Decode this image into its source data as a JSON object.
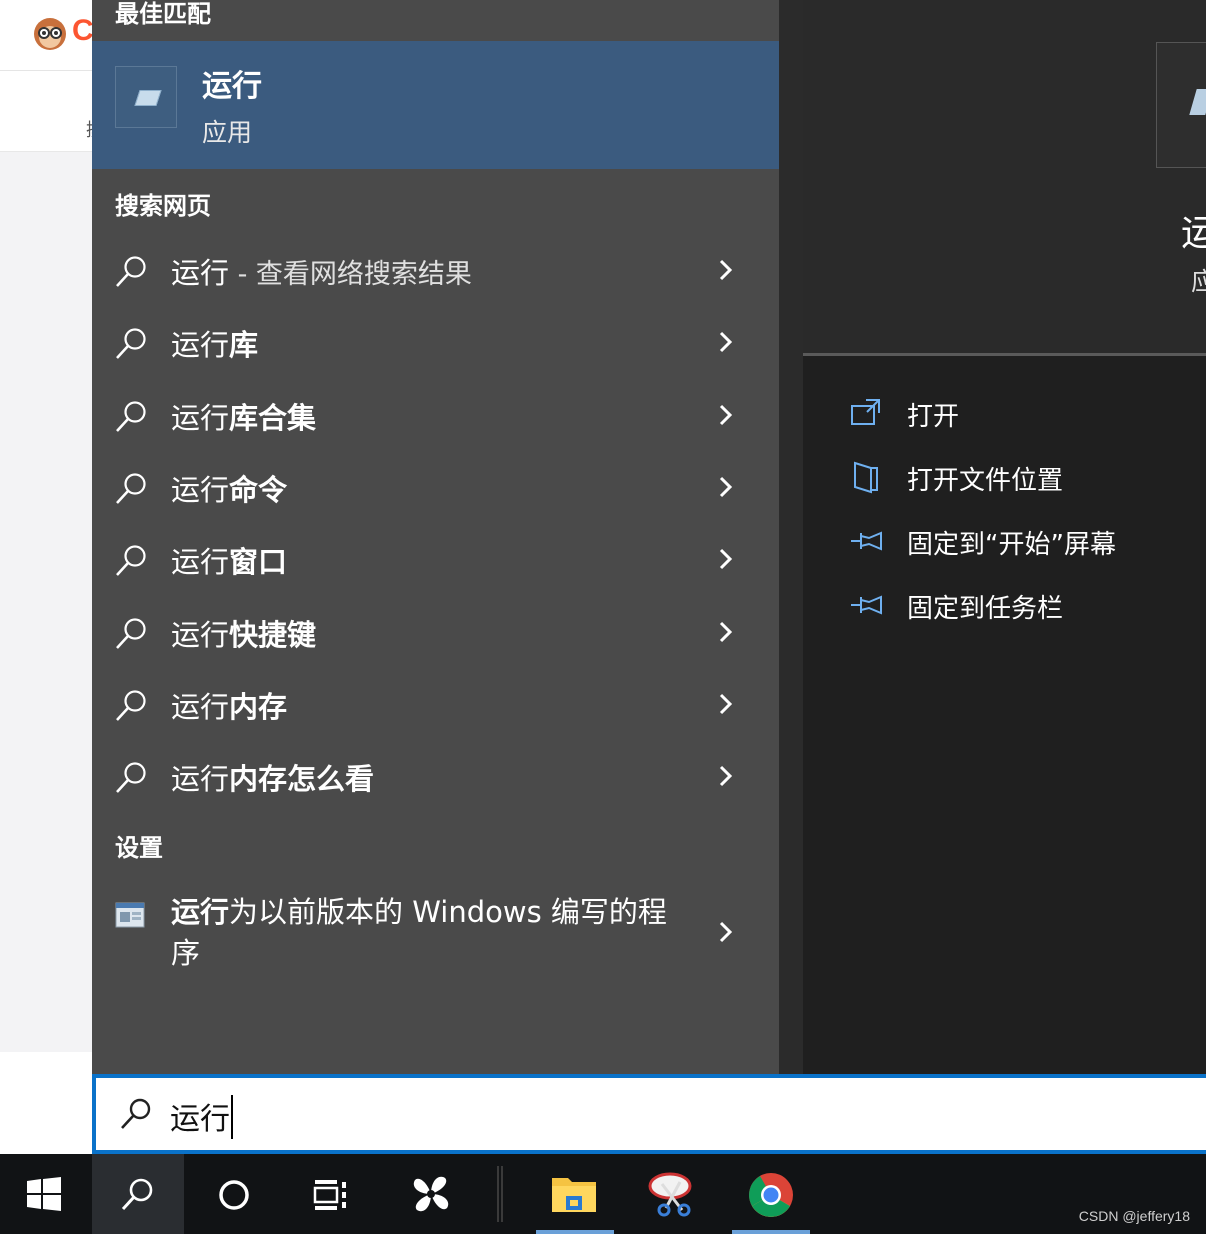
{
  "background_page": {
    "logo_letter": "C",
    "sub_glyph": "摸"
  },
  "results": {
    "best_match_header": "最佳匹配",
    "best_match": {
      "title": "运行",
      "type": "应用",
      "icon": "run-app-icon"
    },
    "web_header": "搜索网页",
    "web_results": [
      {
        "prefix": "运行",
        "suffix": "",
        "note": " - 查看网络搜索结果"
      },
      {
        "prefix": "运行",
        "suffix": "库",
        "note": ""
      },
      {
        "prefix": "运行",
        "suffix": "库合集",
        "note": ""
      },
      {
        "prefix": "运行",
        "suffix": "命令",
        "note": ""
      },
      {
        "prefix": "运行",
        "suffix": "窗口",
        "note": ""
      },
      {
        "prefix": "运行",
        "suffix": "快捷键",
        "note": ""
      },
      {
        "prefix": "运行",
        "suffix": "内存",
        "note": ""
      },
      {
        "prefix": "运行",
        "suffix": "内存怎么看",
        "note": ""
      }
    ],
    "settings_header": "设置",
    "settings_result": {
      "bold": "运行",
      "rest": "为以前版本的 Windows 编写的程序",
      "icon": "compatibility-settings-icon"
    }
  },
  "detail": {
    "title": "运",
    "type": "应",
    "actions": [
      {
        "label": "打开",
        "icon": "open-icon"
      },
      {
        "label": "打开文件位置",
        "icon": "file-location-icon"
      },
      {
        "label": "固定到“开始”屏幕",
        "icon": "pin-icon"
      },
      {
        "label": "固定到任务栏",
        "icon": "pin-icon"
      }
    ]
  },
  "search": {
    "value": "运行"
  },
  "taskbar": {
    "items": [
      "windows-start-icon",
      "search-icon",
      "cortana-icon",
      "task-view-icon",
      "pinwheel-app-icon",
      "file-explorer-icon",
      "snipping-tool-icon",
      "chrome-icon"
    ],
    "watermark": "CSDN @jeffery18"
  },
  "colors": {
    "results_bg": "#4a4a4a",
    "best_match_bg": "#3b5b7f",
    "detail_bg": "#1f1f1f",
    "accent": "#0a72c9",
    "taskbar_bg": "#111315"
  }
}
